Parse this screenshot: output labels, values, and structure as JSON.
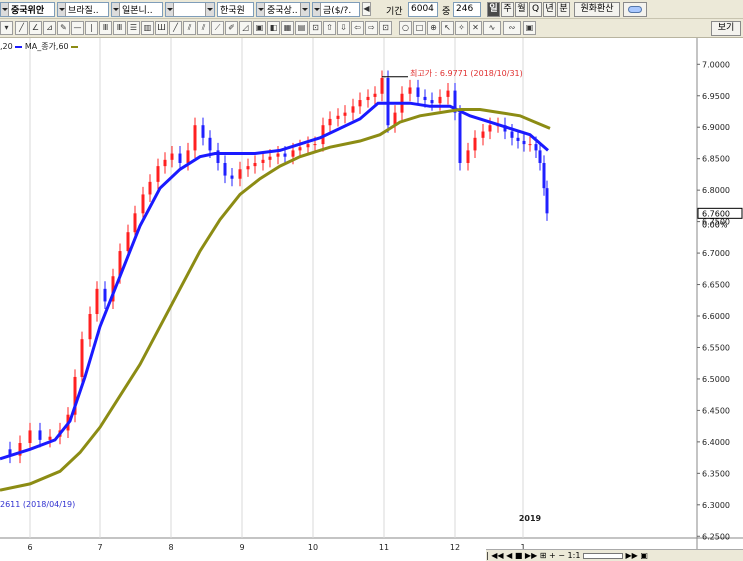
{
  "toolbar": {
    "combos": [
      {
        "text": "중국위안"
      },
      {
        "text": "브라질.."
      },
      {
        "text": "일본니.."
      },
      {
        "text": ""
      },
      {
        "text": "한국원"
      },
      {
        "text": "중국상.."
      },
      {
        "text": "금($/?."
      }
    ],
    "period_label": "기간",
    "period_value": "6004",
    "count_label": "중",
    "count_value": "246",
    "period_buttons": [
      "일",
      "주",
      "월",
      "Q",
      "년",
      "분"
    ],
    "selected_period": "일",
    "convert_label": "원화환산",
    "view_label": "보기"
  },
  "legend": {
    "ma_short": ",20",
    "ma_long_label": "MA_종가,60"
  },
  "annotations": {
    "high": "최고가 : 6.9771 (2018/10/31)",
    "low": "2611 (2018/04/19)"
  },
  "price_labels": {
    "current": "6.7600",
    "change": "0.00%"
  },
  "bottom_bar": {
    "zoom": "1:1"
  },
  "chart_data": {
    "type": "candlestick",
    "x_tick_labels": [
      "6",
      "7",
      "8",
      "9",
      "10",
      "11",
      "12",
      "1"
    ],
    "year_label": "2019",
    "y_tick_labels": [
      "7.0000",
      "6.9500",
      "6.9000",
      "6.8500",
      "6.8000",
      "6.7500",
      "6.7000",
      "6.6500",
      "6.6000",
      "6.5500",
      "6.5000",
      "6.4500",
      "6.4000",
      "6.3500",
      "6.3000",
      "6.2500"
    ],
    "ylim": [
      6.225,
      7.01
    ],
    "series": [
      {
        "name": "종가",
        "color": "#000000"
      },
      {
        "name": "MA20",
        "color": "#1a1aff"
      },
      {
        "name": "MA_종가,60",
        "color": "#8c8c14"
      }
    ],
    "high": {
      "value": 6.9771,
      "date": "2018/10/31"
    },
    "last": 6.76,
    "up_color": "#ff2020",
    "down_color": "#2020ff"
  }
}
